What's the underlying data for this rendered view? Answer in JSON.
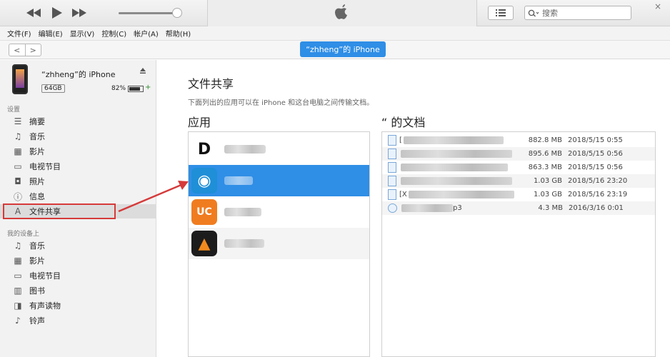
{
  "toolbar": {
    "prev_icon": "rewind-icon",
    "play_icon": "play-icon",
    "next_icon": "fast-forward-icon",
    "search_placeholder": "搜索",
    "close_glyph": "×"
  },
  "menu": [
    "文件(F)",
    "编辑(E)",
    "显示(V)",
    "控制(C)",
    "帐户(A)",
    "帮助(H)"
  ],
  "nav": {
    "back": "<",
    "forward": ">",
    "device_pill": "“zhheng”的 iPhone"
  },
  "device": {
    "name": "“zhheng”的 iPhone",
    "capacity": "64GB",
    "battery": "82%",
    "battery_level": 0.82
  },
  "sidebar": {
    "settings_label": "设置",
    "settings_items": [
      {
        "label": "摘要",
        "icon": "summary-icon"
      },
      {
        "label": "音乐",
        "icon": "music-icon"
      },
      {
        "label": "影片",
        "icon": "film-icon"
      },
      {
        "label": "电视节目",
        "icon": "tv-icon"
      },
      {
        "label": "照片",
        "icon": "camera-icon"
      },
      {
        "label": "信息",
        "icon": "info-icon"
      },
      {
        "label": "文件共享",
        "icon": "app-store-icon"
      }
    ],
    "mydevice_label": "我的设备上",
    "mydevice_items": [
      {
        "label": "音乐",
        "icon": "music-icon"
      },
      {
        "label": "影片",
        "icon": "film-icon"
      },
      {
        "label": "电视节目",
        "icon": "tv-icon"
      },
      {
        "label": "图书",
        "icon": "book-icon"
      },
      {
        "label": "有声读物",
        "icon": "audiobook-icon"
      },
      {
        "label": "铃声",
        "icon": "bell-icon"
      }
    ]
  },
  "main": {
    "title": "文件共享",
    "subtitle": "下面列出的应用可以在 iPhone 和这台电脑之间传输文档。",
    "apps_header": "应用",
    "docs_header": "“          的文档",
    "apps": [
      {
        "glyph": "D",
        "color": "#ffffff"
      },
      {
        "glyph": "◉",
        "color": "#1f8fd8"
      },
      {
        "glyph": "UC",
        "color": "#f07c20"
      },
      {
        "glyph": "▲",
        "color": "#1c1c1c"
      }
    ],
    "documents": [
      {
        "prefix": "[",
        "size": "882.8 MB",
        "date": "2018/5/15 0:55"
      },
      {
        "prefix": "",
        "size": "895.6 MB",
        "date": "2018/5/15 0:56"
      },
      {
        "prefix": "",
        "size": "863.3 MB",
        "date": "2018/5/15 0:56"
      },
      {
        "prefix": "",
        "size": "1.03 GB",
        "date": "2018/5/16 23:20"
      },
      {
        "prefix": "[X",
        "size": "1.03 GB",
        "date": "2018/5/16 23:19"
      },
      {
        "prefix": "",
        "suffix": "p3",
        "size": "4.3 MB",
        "date": "2016/3/16 0:01"
      }
    ]
  }
}
